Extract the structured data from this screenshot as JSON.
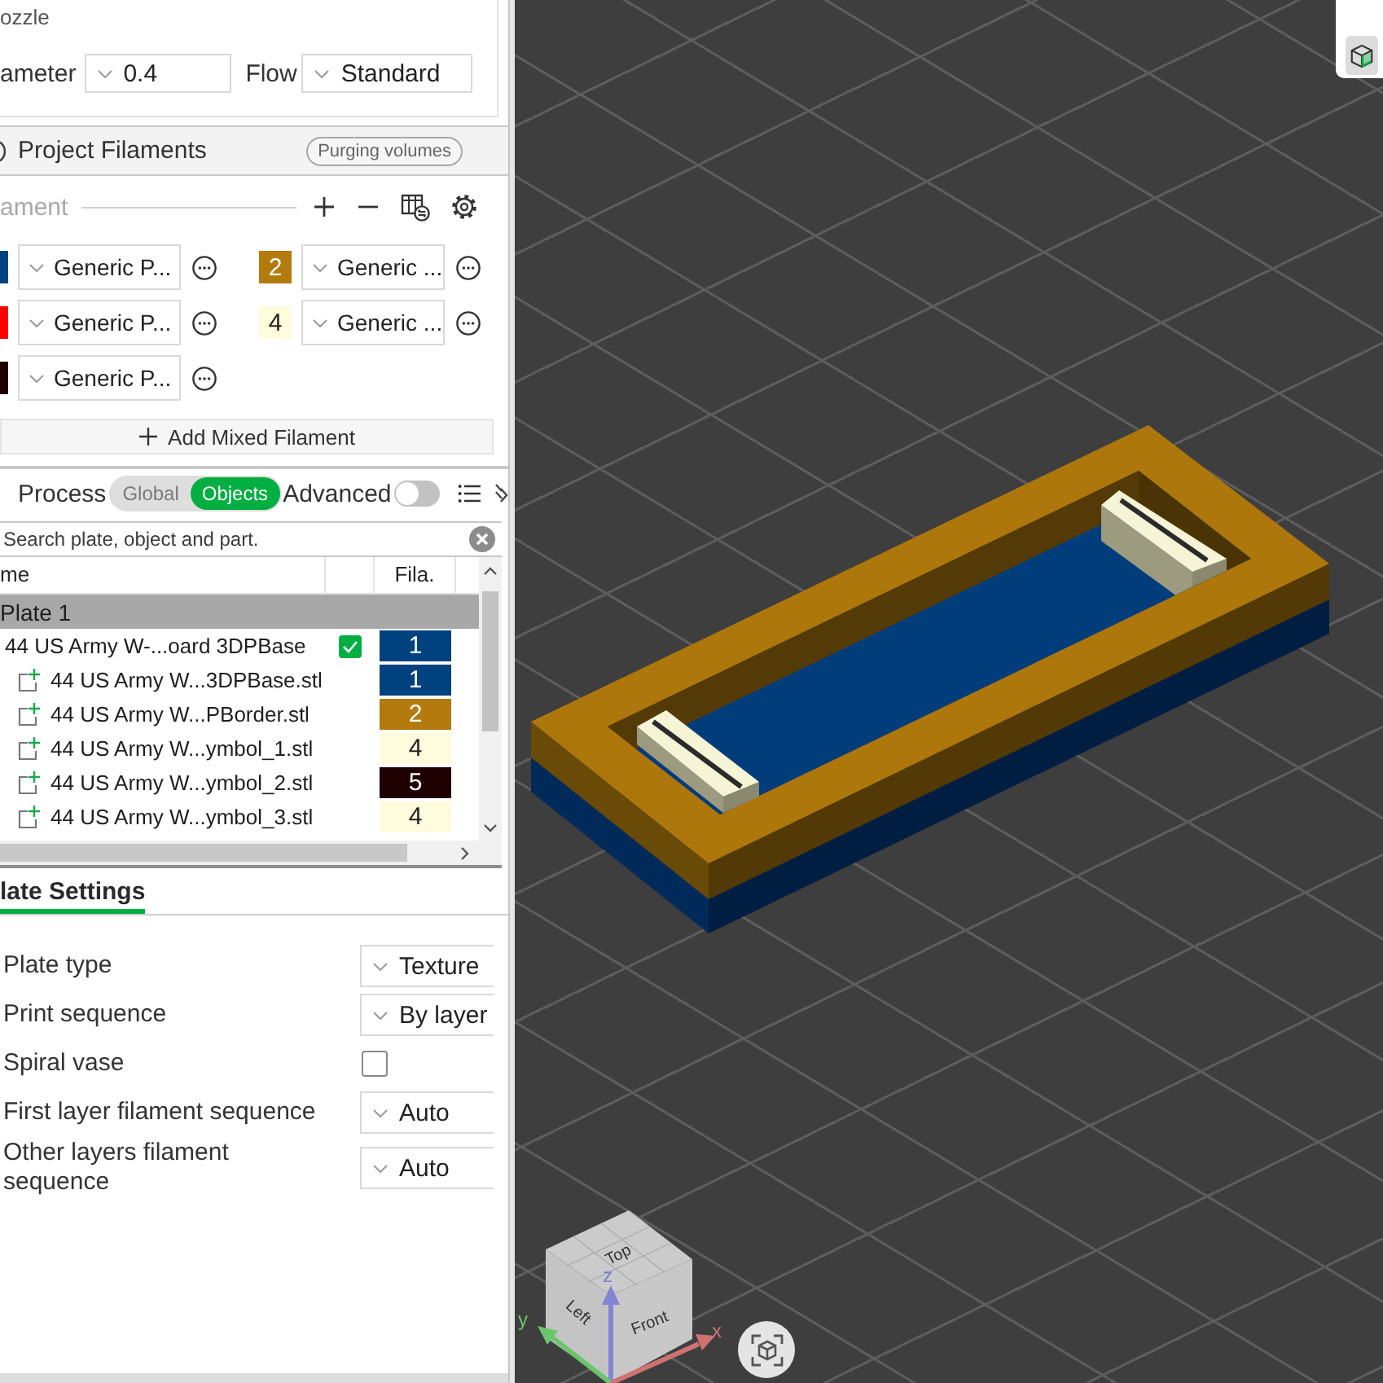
{
  "nozzle": {
    "title": "ozzle",
    "diameter_label": "ameter",
    "diameter": "0.4",
    "flow_label": "Flow",
    "flow": "Standard"
  },
  "filaments": {
    "title": "Project Filaments",
    "purging_button": "Purging volumes",
    "list_label": "ament",
    "items": [
      {
        "color": "#00417f",
        "name": "Generic P..."
      },
      {
        "color": "#b37a0e",
        "number": "2",
        "name": "Generic ..."
      },
      {
        "color": "#ff0000",
        "name": "Generic P..."
      },
      {
        "color": "#fffbdc",
        "number": "4",
        "name": "Generic ..."
      },
      {
        "color": "#1f0000",
        "name": "Generic P..."
      }
    ],
    "add_mixed_button": "Add Mixed Filament"
  },
  "process": {
    "title": "Process",
    "modes": [
      {
        "label": "Global",
        "selected": false
      },
      {
        "label": "Objects",
        "selected": true
      }
    ],
    "advanced": {
      "label": "Advanced",
      "on": false
    }
  },
  "search": {
    "placeholder": "Search plate, object and part."
  },
  "object_list": {
    "columns": [
      {
        "label": "me"
      },
      {
        "label": "Fila."
      }
    ],
    "rows": [
      {
        "kind": "plate",
        "name": "Plate 1",
        "children": [
          {
            "kind": "object",
            "name": "44 US Army W-...oard 3DPBase",
            "printable": true,
            "filament": "1",
            "color": "#00417f",
            "children": [
              {
                "kind": "part",
                "name": "44 US Army W...3DPBase.stl",
                "filament": "1",
                "color": "#00417f"
              },
              {
                "kind": "part",
                "name": "44 US Army W...PBorder.stl",
                "filament": "2",
                "color": "#b37a0e"
              },
              {
                "kind": "part",
                "name": "44 US Army W...ymbol_1.stl",
                "filament": "4",
                "color": "#fffbdc"
              },
              {
                "kind": "part",
                "name": "44 US Army W...ymbol_2.stl",
                "filament": "5",
                "color": "#1f0000"
              },
              {
                "kind": "part",
                "name": "44 US Army W...ymbol_3.stl",
                "filament": "4",
                "color": "#fffbdc"
              }
            ]
          }
        ]
      }
    ]
  },
  "plate_settings": {
    "tabs": [
      {
        "label": "late Settings",
        "selected": true
      }
    ],
    "rows": [
      {
        "kind": "dropdown",
        "label": "Plate type",
        "value": "Texture"
      },
      {
        "kind": "dropdown",
        "label": "Print sequence",
        "value": "By layer"
      },
      {
        "kind": "checkbox",
        "label": "Spiral vase",
        "checked": false
      },
      {
        "kind": "dropdown",
        "label": "First layer filament sequence",
        "value": "Auto"
      },
      {
        "kind": "dropdown",
        "label": "Other layers filament sequence",
        "value": "Auto"
      }
    ]
  },
  "viewport": {
    "view_cube": {
      "top": "Top",
      "left": "Left",
      "front": "Front"
    },
    "axis_labels": {
      "x": "x",
      "y": "y",
      "z": "z"
    }
  }
}
